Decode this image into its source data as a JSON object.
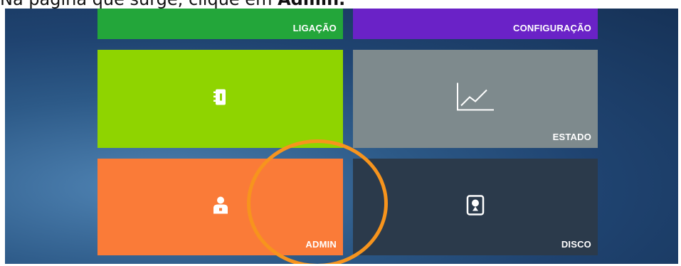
{
  "caption": {
    "text": "Na página que surge, clique em ",
    "bold": "Admin."
  },
  "tiles": {
    "ligacao": {
      "label": "LIGAÇÃO"
    },
    "configuracao": {
      "label": "CONFIGURAÇÃO"
    },
    "green": {
      "label": "",
      "icon": "notebook-icon"
    },
    "estado": {
      "label": "ESTADO",
      "icon": "line-chart-icon"
    },
    "admin": {
      "label": "ADMIN",
      "icon": "user-icon"
    },
    "disco": {
      "label": "DISCO",
      "icon": "disk-icon"
    }
  },
  "colors": {
    "ligacao": "#23a63a",
    "configuracao": "#6a22c7",
    "green": "#8fd400",
    "estado": "#7e8a8d",
    "admin": "#fa7b38",
    "disco": "#2b3a4b",
    "highlight": "#f7941d"
  }
}
